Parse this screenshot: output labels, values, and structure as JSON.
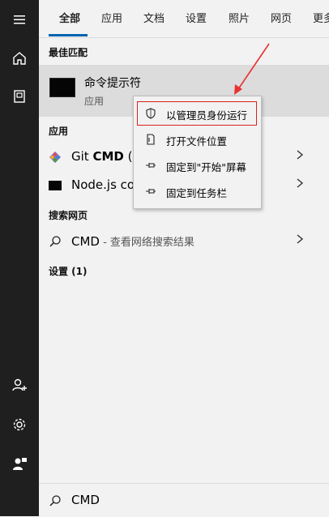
{
  "tabs": [
    {
      "label": "全部",
      "active": true
    },
    {
      "label": "应用"
    },
    {
      "label": "文档"
    },
    {
      "label": "设置"
    },
    {
      "label": "照片"
    },
    {
      "label": "网页"
    },
    {
      "label": "更多"
    }
  ],
  "sections": {
    "best_match": "最佳匹配",
    "apps": "应用",
    "web": "搜索网页",
    "settings": "设置 (1)"
  },
  "best_match_item": {
    "name": "命令提示符",
    "type": "应用",
    "icon": "cmd-window-icon"
  },
  "apps": [
    {
      "label_bold_prefix": "Git ",
      "label_bold": "CMD",
      "label_rest": " (D",
      "icon": "git-diamond-icon"
    },
    {
      "label": "Node.js co",
      "icon": "node-console-icon"
    }
  ],
  "web_result": {
    "query": "CMD",
    "suffix": " - 查看网络搜索结果",
    "icon": "search-icon"
  },
  "context_menu": [
    {
      "label": "以管理员身份运行",
      "icon": "shield-icon",
      "highlighted": true
    },
    {
      "label": "打开文件位置",
      "icon": "file-location-icon"
    },
    {
      "label": "固定到\"开始\"屏幕",
      "icon": "pin-icon"
    },
    {
      "label": "固定到任务栏",
      "icon": "pin-icon"
    }
  ],
  "search_box": {
    "value": "CMD",
    "icon": "search-icon"
  },
  "rail_icons": [
    "hamburger-menu-icon",
    "home-icon",
    "document-icon",
    "add-user-icon",
    "gear-icon",
    "user-feedback-icon"
  ],
  "colors": {
    "accent": "#0063b1",
    "highlight_red": "#d9201f",
    "rail": "#1f1f1f",
    "selected_bg": "#dcdcdc"
  }
}
